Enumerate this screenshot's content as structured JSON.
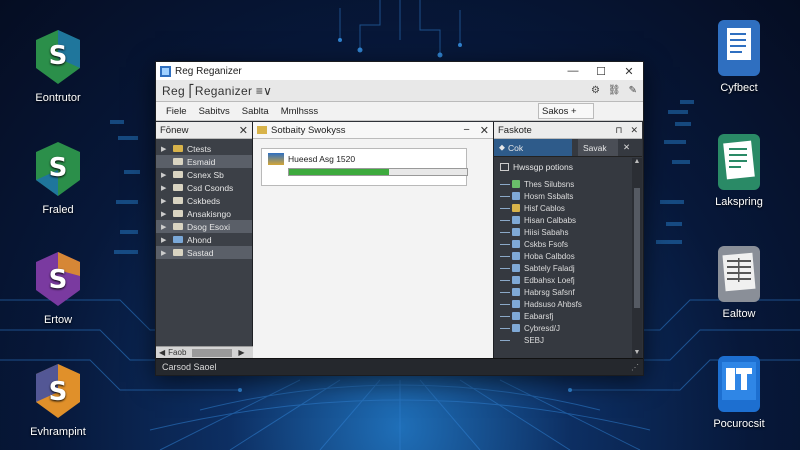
{
  "desktop": {
    "left_icons": [
      {
        "label": "Eontrutor",
        "icon": "s-app-icon",
        "color": "#2b8f4a"
      },
      {
        "label": "Fraled",
        "icon": "s-app-icon",
        "color": "#2b8f4a"
      },
      {
        "label": "Ertow",
        "icon": "s-app-icon",
        "color": "#7a3aa0"
      },
      {
        "label": "Evhrampint",
        "icon": "s-app-icon",
        "color": "#e0902a"
      }
    ],
    "right_icons": [
      {
        "label": "Cyfbect",
        "icon": "document-icon"
      },
      {
        "label": "Lakspring",
        "icon": "document-icon"
      },
      {
        "label": "Ealtow",
        "icon": "spreadsheet-icon"
      },
      {
        "label": "Pocurocsit",
        "icon": "powerpoint-icon"
      }
    ]
  },
  "window": {
    "title": "Reg Reganizer",
    "address": "Reg ⎡Reganizer ≡∨",
    "controls": {
      "minimize": "—",
      "maximize": "☐",
      "close": "✕"
    },
    "menu": [
      "Fiele",
      "Sabitvs",
      "Sablta",
      "Mmlhsss"
    ],
    "side_tab": "Sakos +"
  },
  "left_pane": {
    "title": "Fōnew",
    "items": [
      {
        "label": "Ctests",
        "selected": false
      },
      {
        "label": "Esmaid",
        "selected": true
      },
      {
        "label": "Csnex Sb",
        "selected": false
      },
      {
        "label": "Csd Csonds",
        "selected": false
      },
      {
        "label": "Cskbeds",
        "selected": false
      },
      {
        "label": "Ansakisngo",
        "selected": false
      },
      {
        "label": "Dsog Esoxi",
        "selected": true
      },
      {
        "label": "Ahond",
        "selected": false
      },
      {
        "label": "Sastad",
        "selected": true
      }
    ],
    "scroll_label": "Faob"
  },
  "center_pane": {
    "title": "Sotbaity Swokyss",
    "task": {
      "label": "Hueesd Asg 1520",
      "progress": 0.56
    }
  },
  "right_pane": {
    "title": "Faskote",
    "tabs": [
      {
        "label": "Cok",
        "active": true
      },
      {
        "label": "Savak",
        "active": false
      }
    ],
    "group": "Hwssgp potions",
    "items": [
      "Thes Silubsns",
      "Hosm Ssbalts",
      "Hisf Cablos",
      "Hisan Calbabs",
      "Hiisi Sabahs",
      "Cskbs Fsofs",
      "Hoba Calbdos",
      "Sabtely Faladj",
      "Edbahsx Loefj",
      "Habrsg Safsnf",
      "Hadsuso Ahbsfs",
      "Eabarsfj",
      "Cybresd/J",
      "SEBJ"
    ]
  },
  "status": {
    "text": "Carsod Saoel",
    "grip": "⋰"
  }
}
